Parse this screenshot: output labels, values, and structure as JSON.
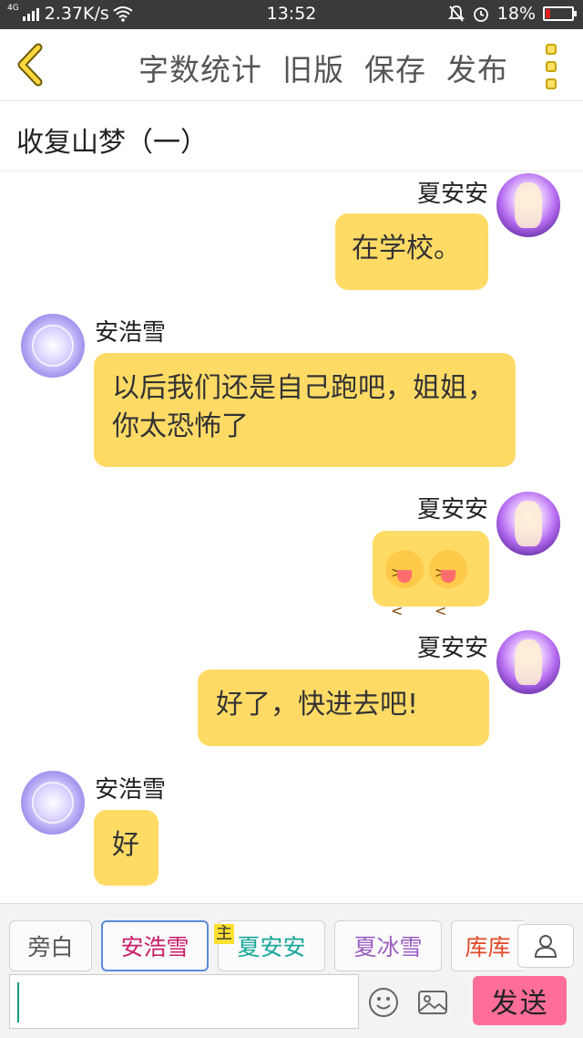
{
  "status_bar": {
    "network_type": "4G",
    "speed": "2.37K/s",
    "time": "13:52",
    "battery": "18%",
    "battery_level": 0.18,
    "battery_color": "#e02020"
  },
  "header": {
    "back_icon": "chevron-left-icon",
    "actions": [
      "字数统计",
      "旧版",
      "保存",
      "发布"
    ],
    "more_icon": "more-vertical-icon"
  },
  "chapter": {
    "title": "收复山梦（一）"
  },
  "messages": [
    {
      "sender": "夏安安",
      "side": "right",
      "text": "在学校。"
    },
    {
      "sender": "安浩雪",
      "side": "left",
      "text": "以后我们还是自己跑吧，姐姐，你太恐怖了"
    },
    {
      "sender": "夏安安",
      "side": "right",
      "emoji_count": 2,
      "emoji_icon": "squinting-tongue-emoji"
    },
    {
      "sender": "夏安安",
      "side": "right",
      "text": "好了，快进去吧!"
    },
    {
      "sender": "安浩雪",
      "side": "left",
      "text": "好"
    }
  ],
  "roles": [
    {
      "name": "旁白",
      "color": "#555555"
    },
    {
      "name": "安浩雪",
      "color": "#c81e68",
      "selected": true
    },
    {
      "name": "夏安安",
      "color": "#19a79a",
      "main_badge": "主"
    },
    {
      "name": "夏冰雪",
      "color": "#9b5fc0"
    },
    {
      "name": "库库",
      "color": "#e04a2a"
    }
  ],
  "input": {
    "value": "",
    "send_label": "发送",
    "send_color": "#ff6e9a"
  },
  "colors": {
    "accent": "#ffdb66"
  }
}
